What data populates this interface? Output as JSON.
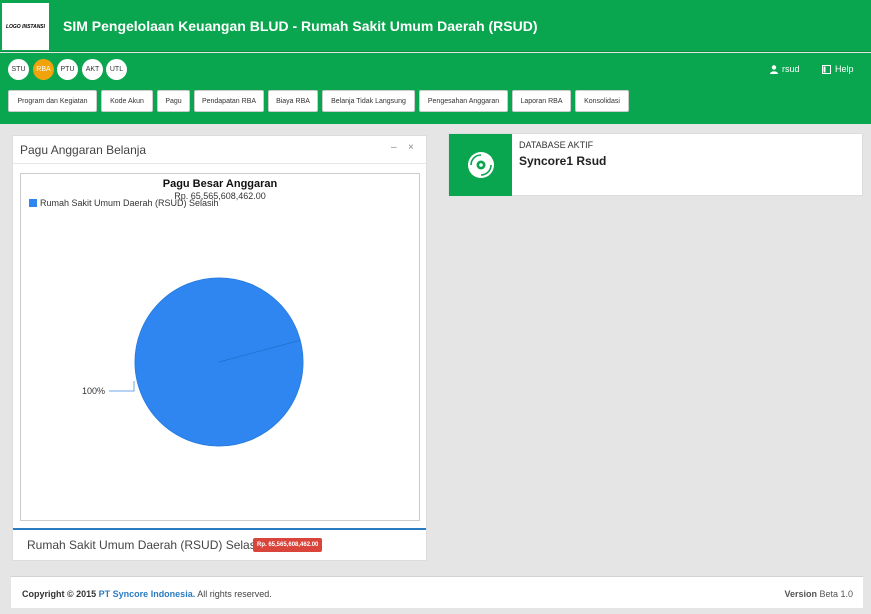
{
  "header": {
    "logo_text": "LOGO INSTANSI",
    "app_title": "SIM Pengelolaan Keuangan BLUD -  Rumah Sakit Umum Daerah (RSUD)"
  },
  "modules": [
    {
      "label": "STU",
      "active": false
    },
    {
      "label": "RBA",
      "active": true
    },
    {
      "label": "PTU",
      "active": false
    },
    {
      "label": "AKT",
      "active": false
    },
    {
      "label": "UTL",
      "active": false
    }
  ],
  "user": {
    "name": "rsud",
    "help": "Help"
  },
  "menu": [
    "Program dan Kegiatan",
    "Kode Akun",
    "Pagu",
    "Pendapatan RBA",
    "Biaya RBA",
    "Belanja Tidak Langsung",
    "Pengesahan Anggaran",
    "Laporan RBA",
    "Konsolidasi"
  ],
  "panel": {
    "title": "Pagu Anggaran Belanja",
    "minimize": "–",
    "close": "×",
    "footer_label": "Rumah Sakit Umum Daerah (RSUD) Selasih",
    "footer_badge": "Rp. 65,565,608,462.00"
  },
  "chart_data": {
    "type": "pie",
    "title": "Pagu Besar Anggaran",
    "subtitle": "Rp. 65,565,608,462.00",
    "series": [
      {
        "name": "Rumah Sakit Umum Daerah (RSUD) Selasih",
        "value": 100,
        "label": "100%",
        "color": "#2f86f0"
      }
    ],
    "legend_position": "top-left"
  },
  "info": {
    "label": "DATABASE AKTIF",
    "value": "Syncore1 Rsud",
    "icon": "disc-icon"
  },
  "footer": {
    "copyright_prefix": "Copyright © 2015",
    "company": "PT Syncore Indonesia.",
    "rights": " All rights reserved.",
    "version_label": "Version",
    "version_value": " Beta 1.0"
  }
}
